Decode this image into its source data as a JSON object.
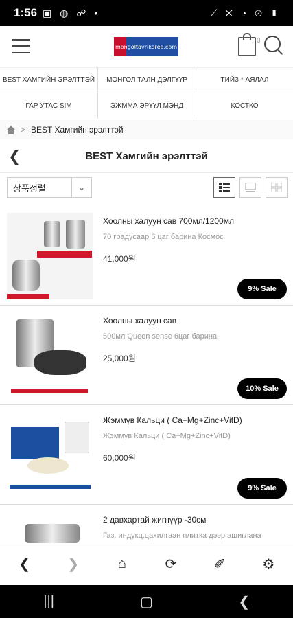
{
  "status": {
    "time": "1:56",
    "left_icons": "▣ ◍ ☍ •",
    "right_icons": "⟋ ✕ ◔ ⊘ ▮"
  },
  "header": {
    "logo_text": "mongoltavrikorea.com",
    "cart_count": "0"
  },
  "categories": [
    "BEST ХАМГИЙН ЭРЭЛТТЭЙ",
    "МОНГОЛ ТАЛН ДЭЛГҮҮР",
    "ТИЙЗ * АЯЛАЛ",
    "ГАР УТАС SIM",
    "ЭЖММА ЭРҮҮЛ МЭНД",
    "КОСТКО"
  ],
  "breadcrumb": {
    "current": "BEST Хамгийн эрэлттэй"
  },
  "page": {
    "title": "BEST Хамгийн эрэлттэй"
  },
  "sort": {
    "selected": "상품정렬"
  },
  "products": [
    {
      "name": "Хоолны халуун сав 700мл/1200мл",
      "desc": "70 градусаар 6 цаг барина  Космос",
      "price": "41,000원",
      "badge": "9% Sale"
    },
    {
      "name": "Хоолны халуун сав",
      "desc": "500мл Queen sense          6цаг барина",
      "price": "25,000원",
      "badge": "10% Sale"
    },
    {
      "name": "Жэммүв Кальци ( Ca+Mg+Zinc+VitD)",
      "desc": "Жэммүв Кальци ( Ca+Mg+Zinc+VitD)",
      "price": "60,000원",
      "badge": "9% Sale"
    },
    {
      "name": "2 давхартай жигнүүр -30см",
      "desc": "Газ, индукц,цахилгаан плитка дээр ашиглана",
      "price": "",
      "badge": ""
    }
  ],
  "icons": {
    "back": "back-icon",
    "forward": "forward-icon",
    "home": "home-icon",
    "refresh": "refresh-icon",
    "share": "share-icon",
    "settings": "gear-icon"
  },
  "colors": {
    "sale_badge": "#000000",
    "logo_blue": "#1f4ea3",
    "logo_red": "#c8102e"
  }
}
